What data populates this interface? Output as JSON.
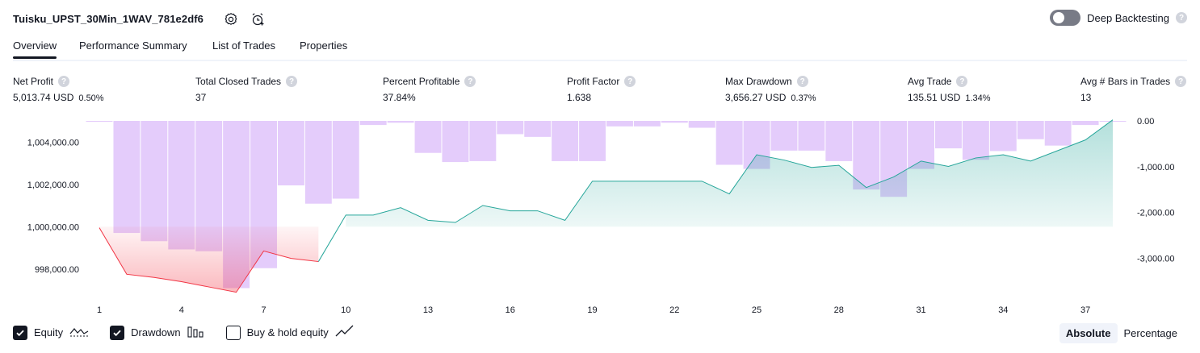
{
  "header": {
    "title": "Tuisku_UPST_30Min_1WAV_781e2df6",
    "icons": [
      "settings-gear-icon",
      "alarm-add-icon"
    ],
    "deep_backtesting_label": "Deep Backtesting",
    "deep_backtesting_enabled": false,
    "help_glyph": "?"
  },
  "tabs": [
    {
      "label": "Overview",
      "active": true
    },
    {
      "label": "Performance Summary",
      "active": false
    },
    {
      "label": "List of Trades",
      "active": false
    },
    {
      "label": "Properties",
      "active": false
    }
  ],
  "metrics": {
    "net_profit": {
      "label": "Net Profit",
      "value": "5,013.74 USD",
      "pct": "0.50%"
    },
    "total_closed_trades": {
      "label": "Total Closed Trades",
      "value": "37"
    },
    "percent_profitable": {
      "label": "Percent Profitable",
      "value": "37.84%"
    },
    "profit_factor": {
      "label": "Profit Factor",
      "value": "1.638"
    },
    "max_drawdown": {
      "label": "Max Drawdown",
      "value": "3,656.27 USD",
      "pct": "0.37%"
    },
    "avg_trade": {
      "label": "Avg Trade",
      "value": "135.51 USD",
      "pct": "1.34%"
    },
    "avg_bars": {
      "label": "Avg # Bars in Trades",
      "value": "13"
    }
  },
  "colors": {
    "profit_green": "#089981",
    "loss_red": "#f23645",
    "drawdown_bar": "#e1c6fb",
    "equity_line_profit": "#26a69a",
    "equity_line_loss": "#f23645"
  },
  "chart_data": {
    "type": "line",
    "x_ticks": [
      "1",
      "4",
      "7",
      "10",
      "13",
      "16",
      "19",
      "22",
      "25",
      "28",
      "31",
      "34",
      "37"
    ],
    "left_axis": {
      "ticks": [
        "1,004,000.00",
        "1,002,000.00",
        "1,000,000.00",
        "998,000.00"
      ],
      "ylim": [
        997000,
        1005000
      ]
    },
    "right_axis": {
      "ticks": [
        "0.00",
        "-1,000.00",
        "-2,000.00",
        "-3,000.00"
      ],
      "ylim": [
        -3700,
        0
      ]
    },
    "baseline": 1000000,
    "series": [
      {
        "name": "Equity",
        "x": [
          1,
          2,
          3,
          4,
          5,
          6,
          7,
          8,
          9,
          10,
          11,
          12,
          13,
          14,
          15,
          16,
          17,
          18,
          19,
          20,
          21,
          22,
          23,
          24,
          25,
          26,
          27,
          28,
          29,
          30,
          31,
          32,
          33,
          34,
          35,
          36,
          37,
          38
        ],
        "values": [
          999950,
          997750,
          997600,
          997400,
          997150,
          996900,
          998850,
          998500,
          998350,
          1000550,
          1000550,
          1000900,
          1000300,
          1000200,
          1001000,
          1000750,
          1000750,
          1000300,
          1002150,
          1002150,
          1002150,
          1002150,
          1002150,
          1001550,
          1003400,
          1003150,
          1002800,
          1002900,
          1001850,
          1002350,
          1003100,
          1002850,
          1003250,
          1003400,
          1003100,
          1003600,
          1004100,
          1005050
        ]
      },
      {
        "name": "Drawdown",
        "x": [
          1,
          2,
          3,
          4,
          5,
          6,
          7,
          8,
          9,
          10,
          11,
          12,
          13,
          14,
          15,
          16,
          17,
          18,
          19,
          20,
          21,
          22,
          23,
          24,
          25,
          26,
          27,
          28,
          29,
          30,
          31,
          32,
          33,
          34,
          35,
          36,
          37,
          38
        ],
        "values": [
          -20,
          -2450,
          -2630,
          -2810,
          -2850,
          -3656,
          -3220,
          -1410,
          -1810,
          -1700,
          -90,
          -40,
          -700,
          -900,
          -880,
          -290,
          -350,
          -880,
          -880,
          -120,
          -120,
          -40,
          -150,
          -960,
          -1050,
          -650,
          -650,
          -880,
          -1500,
          -1660,
          -1050,
          -600,
          -850,
          -660,
          -400,
          -540,
          -90,
          -10
        ]
      }
    ]
  },
  "legend": {
    "items": [
      {
        "label": "Equity",
        "checked": true,
        "icon": "equity-line-icon"
      },
      {
        "label": "Drawdown",
        "checked": true,
        "icon": "drawdown-bars-icon"
      },
      {
        "label": "Buy & hold equity",
        "checked": false,
        "icon": "trend-line-icon"
      }
    ]
  },
  "view_mode": {
    "options": [
      "Absolute",
      "Percentage"
    ],
    "selected": "Absolute"
  }
}
